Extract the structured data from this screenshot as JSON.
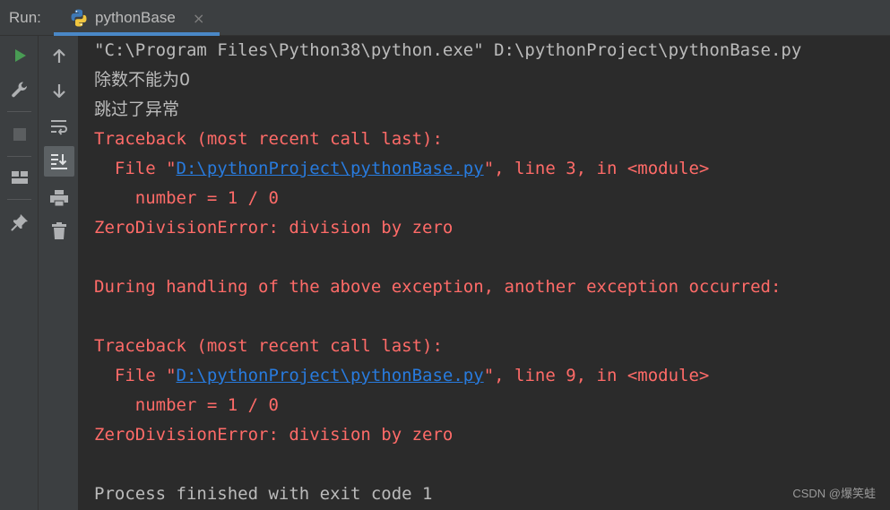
{
  "header": {
    "run_label": "Run:",
    "tab_label": "pythonBase",
    "tab_close": "×"
  },
  "toolbar": {
    "left": [
      "run-icon",
      "wrench-icon",
      "stop-icon",
      "layout-icon",
      "pin-icon"
    ],
    "right": [
      "arrow-up-icon",
      "arrow-down-icon",
      "soft-wrap-icon",
      "scroll-to-end-icon",
      "print-icon",
      "trash-icon"
    ]
  },
  "console": {
    "command": "\"C:\\Program Files\\Python38\\python.exe\" D:\\pythonProject\\pythonBase.py",
    "out1": "除数不能为0",
    "out2": "跳过了异常",
    "tb1": {
      "header": "Traceback (most recent call last):",
      "file_prefix": "  File \"",
      "file_link": "D:\\pythonProject\\pythonBase.py",
      "file_suffix": "\", line 3, in <module>",
      "code": "    number = 1 / 0",
      "error": "ZeroDivisionError: division by zero"
    },
    "during": "During handling of the above exception, another exception occurred:",
    "tb2": {
      "header": "Traceback (most recent call last):",
      "file_prefix": "  File \"",
      "file_link": "D:\\pythonProject\\pythonBase.py",
      "file_suffix": "\", line 9, in <module>",
      "code": "    number = 1 / 0",
      "error": "ZeroDivisionError: division by zero"
    },
    "process": "Process finished with exit code 1"
  },
  "watermark": "CSDN @爆笑蛙",
  "colors": {
    "background": "#2b2b2b",
    "panel": "#3c3f41",
    "text": "#bbbbbb",
    "error": "#ff6b68",
    "link": "#287bde",
    "run_green": "#499c54",
    "tab_underline": "#4a88c7"
  }
}
